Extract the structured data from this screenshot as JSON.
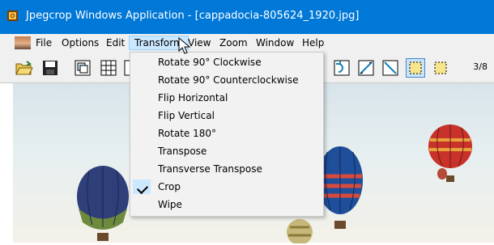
{
  "window": {
    "title": "Jpegcrop Windows Application - [cappadocia-805624_1920.jpg]"
  },
  "menubar": {
    "items": [
      {
        "label": "File"
      },
      {
        "label": "Options"
      },
      {
        "label": "Edit"
      },
      {
        "label": "Transform"
      },
      {
        "label": "View"
      },
      {
        "label": "Zoom"
      },
      {
        "label": "Window"
      },
      {
        "label": "Help"
      }
    ],
    "active": "Transform"
  },
  "toolbar": {
    "left_buttons": [
      "open-folder-icon",
      "save-icon",
      "copy-icon",
      "grid-icon",
      "frame-icon"
    ],
    "right_buttons": [
      "rotate-icon",
      "select-diagonal-icon",
      "select-antidiagonal-icon",
      "crop-icon",
      "select-icon"
    ],
    "pressed_button": "crop-icon",
    "page_indicator": "3/8"
  },
  "transform_menu": {
    "items": [
      {
        "label": "Rotate 90° Clockwise",
        "checked": false
      },
      {
        "label": "Rotate 90° Counterclockwise",
        "checked": false
      },
      {
        "label": "Flip Horizontal",
        "checked": false
      },
      {
        "label": "Flip Vertical",
        "checked": false
      },
      {
        "label": "Rotate 180°",
        "checked": false
      },
      {
        "label": "Transpose",
        "checked": false
      },
      {
        "label": "Transverse Transpose",
        "checked": false
      },
      {
        "label": "Crop",
        "checked": true
      },
      {
        "label": "Wipe",
        "checked": false
      }
    ]
  },
  "colors": {
    "titlebar": "#0078d7",
    "menu_highlight": "#cce8ff",
    "pressed_button": "#cce4f7"
  }
}
